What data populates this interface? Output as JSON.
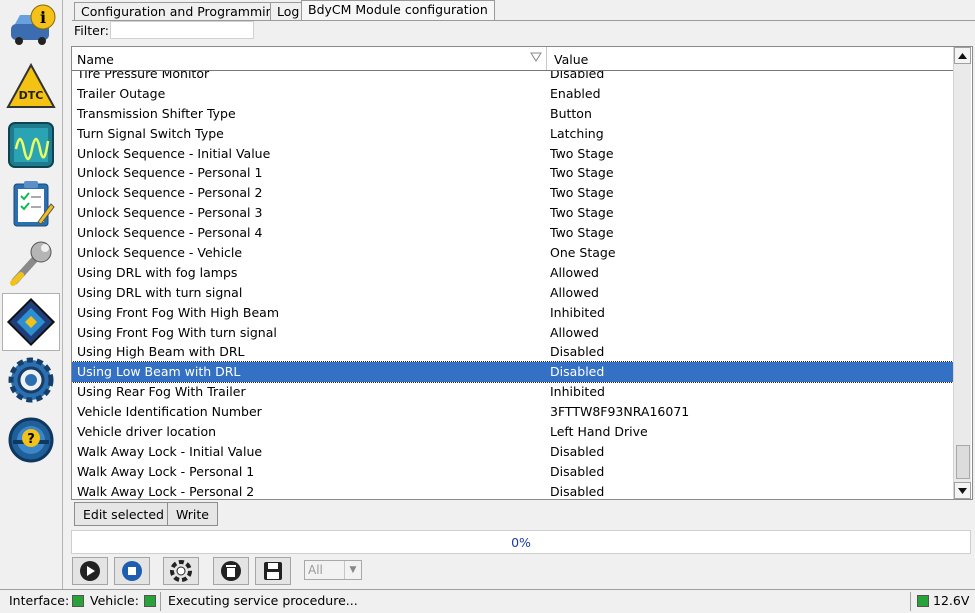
{
  "tabs": [
    {
      "label": "Configuration and Programming",
      "active": false
    },
    {
      "label": "Log",
      "active": false
    },
    {
      "label": "BdyCM Module configuration",
      "active": true
    }
  ],
  "filter": {
    "label": "Filter:",
    "value": ""
  },
  "table": {
    "columns": [
      "Name",
      "Value"
    ],
    "rows": [
      {
        "name": "Tire Pressure Monitor",
        "value": "Disabled"
      },
      {
        "name": "Trailer Outage",
        "value": "Enabled"
      },
      {
        "name": "Transmission Shifter Type",
        "value": "Button"
      },
      {
        "name": "Turn Signal Switch Type",
        "value": "Latching"
      },
      {
        "name": "Unlock Sequence - Initial Value",
        "value": "Two Stage"
      },
      {
        "name": "Unlock Sequence - Personal 1",
        "value": "Two Stage"
      },
      {
        "name": "Unlock Sequence - Personal 2",
        "value": "Two Stage"
      },
      {
        "name": "Unlock Sequence - Personal 3",
        "value": "Two Stage"
      },
      {
        "name": "Unlock Sequence - Personal 4",
        "value": "Two Stage"
      },
      {
        "name": "Unlock Sequence - Vehicle",
        "value": "One Stage"
      },
      {
        "name": "Using DRL with fog lamps",
        "value": "Allowed"
      },
      {
        "name": "Using DRL with turn signal",
        "value": "Allowed"
      },
      {
        "name": "Using Front Fog With High Beam",
        "value": "Inhibited"
      },
      {
        "name": "Using Front Fog With turn signal",
        "value": "Allowed"
      },
      {
        "name": "Using High Beam with DRL",
        "value": "Disabled"
      },
      {
        "name": "Using Low Beam with DRL",
        "value": "Disabled",
        "selected": true
      },
      {
        "name": "Using Rear Fog With Trailer",
        "value": "Inhibited"
      },
      {
        "name": "Vehicle Identification Number",
        "value": "3FTTW8F93NRA16071"
      },
      {
        "name": "Vehicle driver location",
        "value": "Left Hand Drive"
      },
      {
        "name": "Walk Away Lock - Initial Value",
        "value": "Disabled"
      },
      {
        "name": "Walk Away Lock - Personal 1",
        "value": "Disabled"
      },
      {
        "name": "Walk Away Lock - Personal 2",
        "value": "Disabled"
      }
    ]
  },
  "buttons": {
    "edit_selected": "Edit selected",
    "write": "Write"
  },
  "progress": {
    "text": "0%",
    "value": 0
  },
  "toolbar": {
    "all_select": "All"
  },
  "status": {
    "interface_label": "Interface:",
    "vehicle_label": "Vehicle:",
    "message": "Executing service procedure...",
    "voltage": "12.6V"
  },
  "sidebar": {
    "items": [
      "info-car-icon",
      "dtc-icon",
      "oscilloscope-icon",
      "checklist-icon",
      "wrench-icon",
      "module-chip-icon",
      "settings-gear-icon",
      "help-steering-icon"
    ],
    "active_index": 5
  },
  "colors": {
    "selection": "#3470c4",
    "status_led": "#27a33a",
    "progress_text": "#1a3aa0"
  }
}
